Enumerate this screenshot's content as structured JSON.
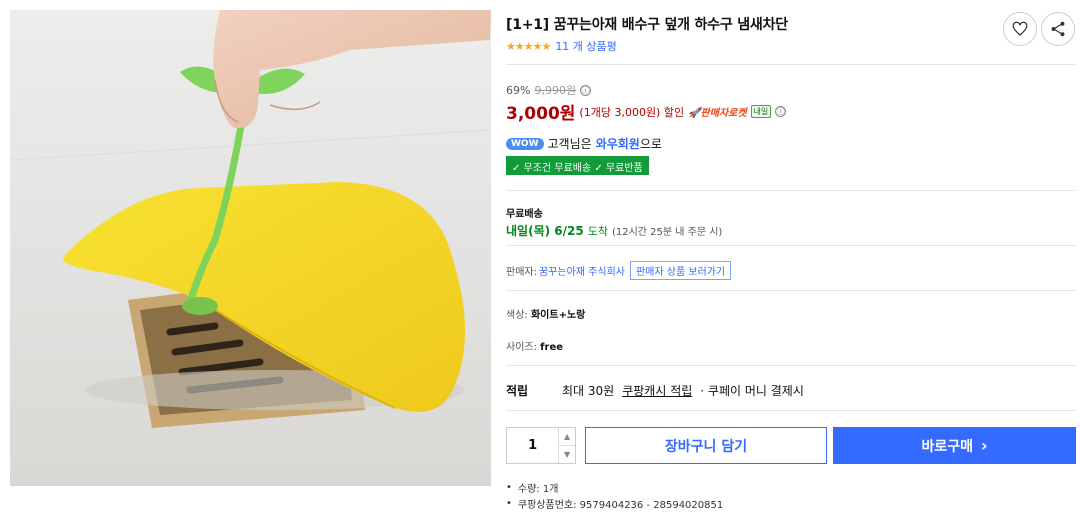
{
  "product": {
    "title": "[1+1] 꿈꾸는아재 배수구 덮개 하수구 냄새차단",
    "stars": "★★★★★",
    "review_count": "11 개 상품평"
  },
  "price": {
    "discount_rate": "69%",
    "original_price": "9,990원",
    "sale_price": "3,000원",
    "unit_price": "(1개당 3,000원) 할인",
    "rocket_label": "🚀판매자로켓",
    "tomorrow_badge": "내일",
    "info_glyph": "ⓘ"
  },
  "membership": {
    "wow_badge": "WOW",
    "text_prefix": "고객님은",
    "link": "와우회원",
    "text_suffix": "으로",
    "benefits": "✓ 무조건 무료배송 ✓ 무료반품"
  },
  "shipping": {
    "label": "무료배송",
    "date": "내일(목) 6/25",
    "arrive": "도착",
    "condition": "(12시간 25분 내 주문 시)"
  },
  "seller": {
    "label": "판매자:",
    "name": "꿈꾸는아재 주식회사",
    "view_button": "판매자 상품 보러가기"
  },
  "options": {
    "color_label": "색상:",
    "color_value": "화이트+노랑",
    "size_label": "사이즈:",
    "size_value": "free"
  },
  "cashback": {
    "label": "적립",
    "max": "최대 30원",
    "link": "쿠팡캐시 적립",
    "suffix": "· 쿠페이 머니 결제시"
  },
  "purchase": {
    "quantity": "1",
    "up_glyph": "▲",
    "down_glyph": "▼",
    "cart_label": "장바구니 담기",
    "buy_label": "바로구매",
    "buy_arrow": "›"
  },
  "notes": {
    "qty": "수량: 1개",
    "product_no": "쿠팡상품번호: 9579404236 - 28594020851"
  },
  "icons": {
    "favorite": "heart-icon",
    "share": "share-icon"
  },
  "colors": {
    "accent_blue": "#346aff",
    "price_red": "#ae0000",
    "benefit_green": "#139b3a",
    "product_yellow": "#f6d92a"
  }
}
